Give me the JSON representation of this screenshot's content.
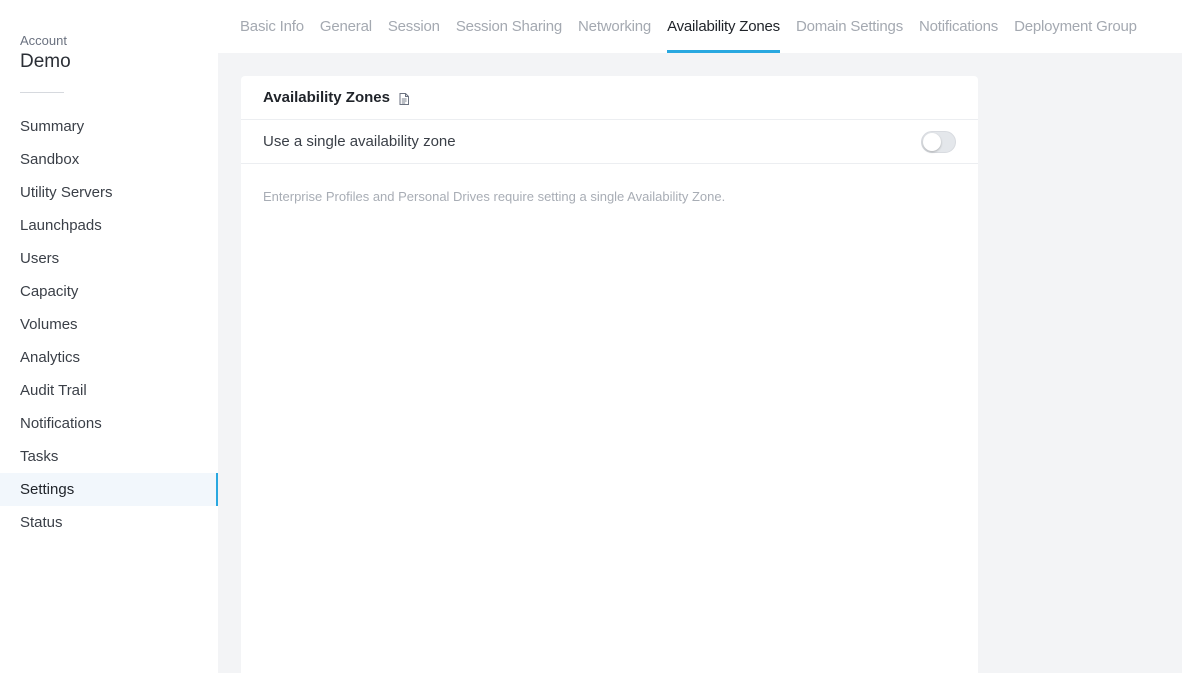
{
  "sidebar": {
    "account_label": "Account",
    "account_name": "Demo",
    "items": [
      {
        "label": "Summary",
        "active": false
      },
      {
        "label": "Sandbox",
        "active": false
      },
      {
        "label": "Utility Servers",
        "active": false
      },
      {
        "label": "Launchpads",
        "active": false
      },
      {
        "label": "Users",
        "active": false
      },
      {
        "label": "Capacity",
        "active": false
      },
      {
        "label": "Volumes",
        "active": false
      },
      {
        "label": "Analytics",
        "active": false
      },
      {
        "label": "Audit Trail",
        "active": false
      },
      {
        "label": "Notifications",
        "active": false
      },
      {
        "label": "Tasks",
        "active": false
      },
      {
        "label": "Settings",
        "active": true
      },
      {
        "label": "Status",
        "active": false
      }
    ]
  },
  "tabs": [
    {
      "label": "Basic Info",
      "active": false
    },
    {
      "label": "General",
      "active": false
    },
    {
      "label": "Session",
      "active": false
    },
    {
      "label": "Session Sharing",
      "active": false
    },
    {
      "label": "Networking",
      "active": false
    },
    {
      "label": "Availability Zones",
      "active": true
    },
    {
      "label": "Domain Settings",
      "active": false
    },
    {
      "label": "Notifications",
      "active": false
    },
    {
      "label": "Deployment Group",
      "active": false
    }
  ],
  "card": {
    "title": "Availability Zones",
    "title_icon": "document-icon",
    "single_zone_label": "Use a single availability zone",
    "single_zone_enabled": false,
    "hint": "Enterprise Profiles and Personal Drives require setting a single Availability Zone."
  },
  "colors": {
    "accent": "#29a8e0",
    "main_background": "#f3f4f6",
    "inactive_tab": "#a4a9b1"
  }
}
